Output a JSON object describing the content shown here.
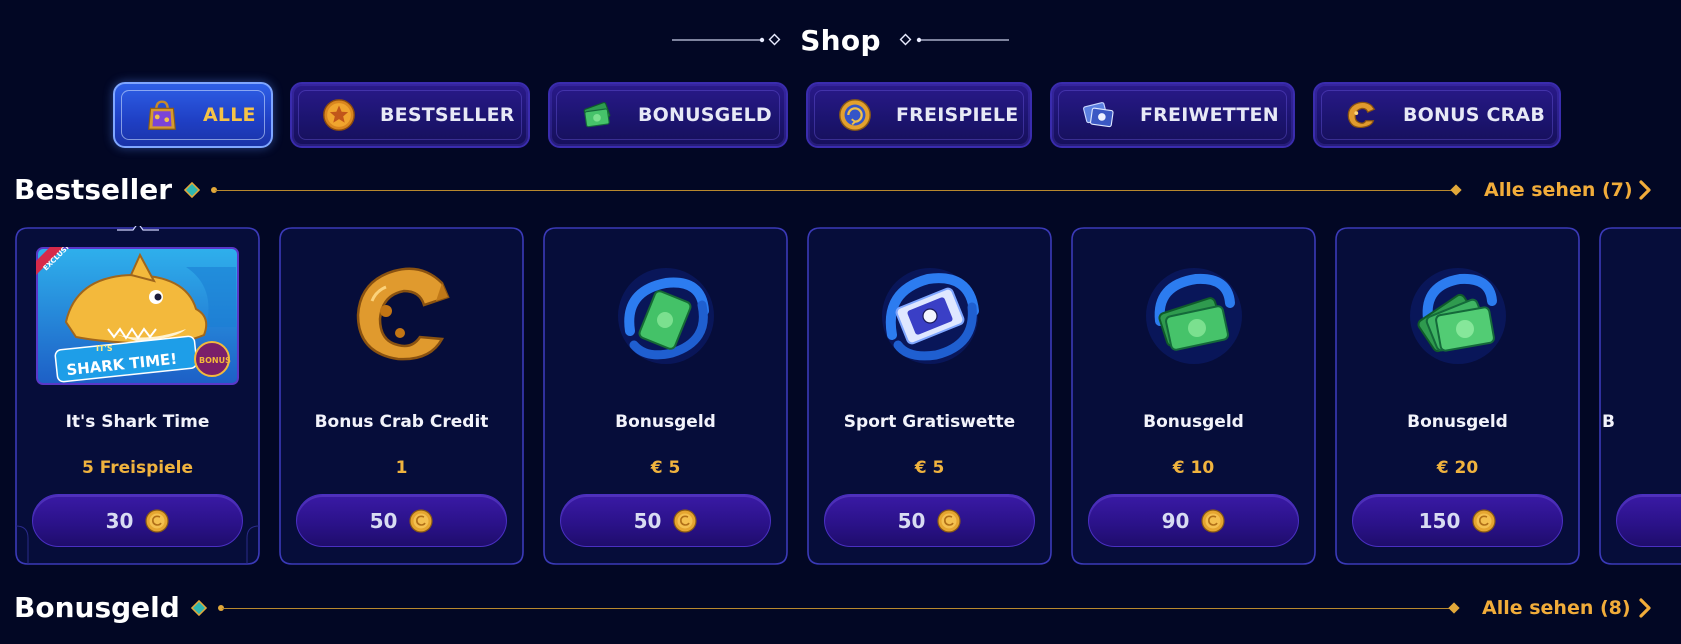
{
  "header": {
    "title": "Shop"
  },
  "tabs": [
    {
      "label": "ALLE",
      "icon": "shopping-bag-icon",
      "active": true
    },
    {
      "label": "BESTSELLER",
      "icon": "star-medal-icon",
      "active": false
    },
    {
      "label": "BONUSGELD",
      "icon": "money-bills-icon",
      "active": false
    },
    {
      "label": "FREISPIELE",
      "icon": "free-spin-coin-icon",
      "active": false
    },
    {
      "label": "FREIWETTEN",
      "icon": "bet-tickets-icon",
      "active": false
    },
    {
      "label": "BONUS CRAB",
      "icon": "crab-claw-icon",
      "active": false
    }
  ],
  "sections": [
    {
      "title": "Bestseller",
      "see_all": "Alle sehen (7)"
    },
    {
      "title": "Bonusgeld",
      "see_all": "Alle sehen (8)"
    }
  ],
  "cards": [
    {
      "name": "It's Shark Time",
      "value": "5 Freispiele",
      "price": "30",
      "image": "shark-time-game-thumbnail",
      "badge": "EXCLUSIVE"
    },
    {
      "name": "Bonus Crab Credit",
      "value": "1",
      "price": "50",
      "image": "crab-claw-coin-icon"
    },
    {
      "name": "Bonusgeld",
      "value": "€ 5",
      "price": "50",
      "image": "bonus-cash-swirl-icon"
    },
    {
      "name": "Sport Gratiswette",
      "value": "€ 5",
      "price": "50",
      "image": "sport-bet-ticket-icon"
    },
    {
      "name": "Bonusgeld",
      "value": "€ 10",
      "price": "90",
      "image": "bonus-cash-stack-icon"
    },
    {
      "name": "Bonusgeld",
      "value": "€ 20",
      "price": "150",
      "image": "bonus-cash-pile-icon"
    },
    {
      "name": "B",
      "value": "",
      "price": "",
      "image": "partial-card"
    }
  ],
  "shark_thumbnail_text": {
    "line1": "IT'S",
    "line2": "SHARK TIME!",
    "badge": "BONUS"
  },
  "colors": {
    "background": "#020724",
    "accent_gold": "#f1ac3a",
    "tab_bg": "#1c1470",
    "tab_active_bg": "#1f3fc4",
    "card_border": "#3b3ab8",
    "button_bg": "#2b128a"
  }
}
